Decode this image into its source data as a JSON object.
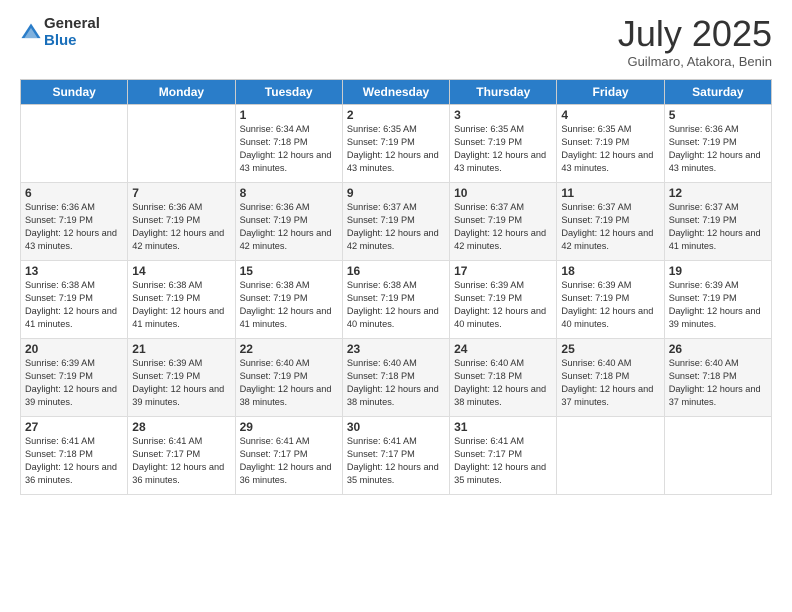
{
  "logo": {
    "general": "General",
    "blue": "Blue"
  },
  "header": {
    "month": "July 2025",
    "location": "Guilmaro, Atakora, Benin"
  },
  "weekdays": [
    "Sunday",
    "Monday",
    "Tuesday",
    "Wednesday",
    "Thursday",
    "Friday",
    "Saturday"
  ],
  "weeks": [
    [
      {
        "day": "",
        "info": ""
      },
      {
        "day": "",
        "info": ""
      },
      {
        "day": "1",
        "info": "Sunrise: 6:34 AM\nSunset: 7:18 PM\nDaylight: 12 hours and 43 minutes."
      },
      {
        "day": "2",
        "info": "Sunrise: 6:35 AM\nSunset: 7:19 PM\nDaylight: 12 hours and 43 minutes."
      },
      {
        "day": "3",
        "info": "Sunrise: 6:35 AM\nSunset: 7:19 PM\nDaylight: 12 hours and 43 minutes."
      },
      {
        "day": "4",
        "info": "Sunrise: 6:35 AM\nSunset: 7:19 PM\nDaylight: 12 hours and 43 minutes."
      },
      {
        "day": "5",
        "info": "Sunrise: 6:36 AM\nSunset: 7:19 PM\nDaylight: 12 hours and 43 minutes."
      }
    ],
    [
      {
        "day": "6",
        "info": "Sunrise: 6:36 AM\nSunset: 7:19 PM\nDaylight: 12 hours and 43 minutes."
      },
      {
        "day": "7",
        "info": "Sunrise: 6:36 AM\nSunset: 7:19 PM\nDaylight: 12 hours and 42 minutes."
      },
      {
        "day": "8",
        "info": "Sunrise: 6:36 AM\nSunset: 7:19 PM\nDaylight: 12 hours and 42 minutes."
      },
      {
        "day": "9",
        "info": "Sunrise: 6:37 AM\nSunset: 7:19 PM\nDaylight: 12 hours and 42 minutes."
      },
      {
        "day": "10",
        "info": "Sunrise: 6:37 AM\nSunset: 7:19 PM\nDaylight: 12 hours and 42 minutes."
      },
      {
        "day": "11",
        "info": "Sunrise: 6:37 AM\nSunset: 7:19 PM\nDaylight: 12 hours and 42 minutes."
      },
      {
        "day": "12",
        "info": "Sunrise: 6:37 AM\nSunset: 7:19 PM\nDaylight: 12 hours and 41 minutes."
      }
    ],
    [
      {
        "day": "13",
        "info": "Sunrise: 6:38 AM\nSunset: 7:19 PM\nDaylight: 12 hours and 41 minutes."
      },
      {
        "day": "14",
        "info": "Sunrise: 6:38 AM\nSunset: 7:19 PM\nDaylight: 12 hours and 41 minutes."
      },
      {
        "day": "15",
        "info": "Sunrise: 6:38 AM\nSunset: 7:19 PM\nDaylight: 12 hours and 41 minutes."
      },
      {
        "day": "16",
        "info": "Sunrise: 6:38 AM\nSunset: 7:19 PM\nDaylight: 12 hours and 40 minutes."
      },
      {
        "day": "17",
        "info": "Sunrise: 6:39 AM\nSunset: 7:19 PM\nDaylight: 12 hours and 40 minutes."
      },
      {
        "day": "18",
        "info": "Sunrise: 6:39 AM\nSunset: 7:19 PM\nDaylight: 12 hours and 40 minutes."
      },
      {
        "day": "19",
        "info": "Sunrise: 6:39 AM\nSunset: 7:19 PM\nDaylight: 12 hours and 39 minutes."
      }
    ],
    [
      {
        "day": "20",
        "info": "Sunrise: 6:39 AM\nSunset: 7:19 PM\nDaylight: 12 hours and 39 minutes."
      },
      {
        "day": "21",
        "info": "Sunrise: 6:39 AM\nSunset: 7:19 PM\nDaylight: 12 hours and 39 minutes."
      },
      {
        "day": "22",
        "info": "Sunrise: 6:40 AM\nSunset: 7:19 PM\nDaylight: 12 hours and 38 minutes."
      },
      {
        "day": "23",
        "info": "Sunrise: 6:40 AM\nSunset: 7:18 PM\nDaylight: 12 hours and 38 minutes."
      },
      {
        "day": "24",
        "info": "Sunrise: 6:40 AM\nSunset: 7:18 PM\nDaylight: 12 hours and 38 minutes."
      },
      {
        "day": "25",
        "info": "Sunrise: 6:40 AM\nSunset: 7:18 PM\nDaylight: 12 hours and 37 minutes."
      },
      {
        "day": "26",
        "info": "Sunrise: 6:40 AM\nSunset: 7:18 PM\nDaylight: 12 hours and 37 minutes."
      }
    ],
    [
      {
        "day": "27",
        "info": "Sunrise: 6:41 AM\nSunset: 7:18 PM\nDaylight: 12 hours and 36 minutes."
      },
      {
        "day": "28",
        "info": "Sunrise: 6:41 AM\nSunset: 7:17 PM\nDaylight: 12 hours and 36 minutes."
      },
      {
        "day": "29",
        "info": "Sunrise: 6:41 AM\nSunset: 7:17 PM\nDaylight: 12 hours and 36 minutes."
      },
      {
        "day": "30",
        "info": "Sunrise: 6:41 AM\nSunset: 7:17 PM\nDaylight: 12 hours and 35 minutes."
      },
      {
        "day": "31",
        "info": "Sunrise: 6:41 AM\nSunset: 7:17 PM\nDaylight: 12 hours and 35 minutes."
      },
      {
        "day": "",
        "info": ""
      },
      {
        "day": "",
        "info": ""
      }
    ]
  ]
}
